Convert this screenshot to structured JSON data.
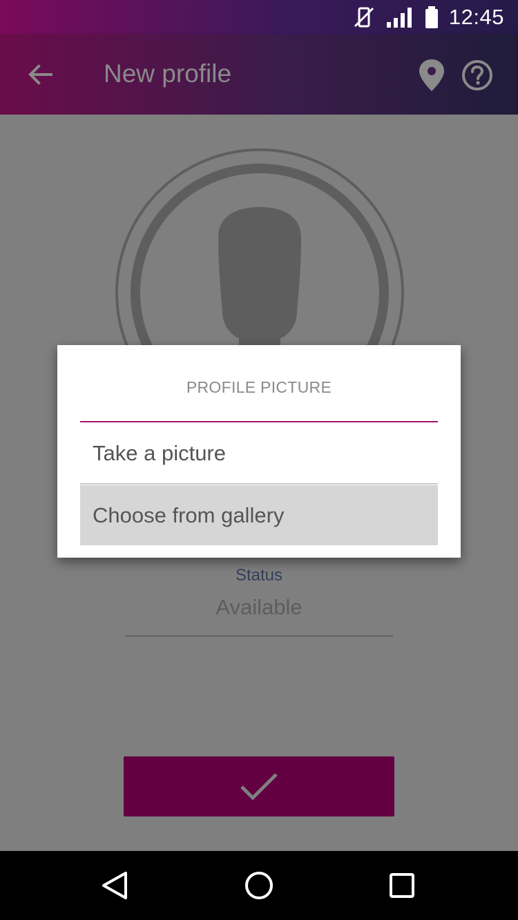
{
  "status_bar": {
    "time": "12:45",
    "icons": [
      "vibrate-mute-icon",
      "signal-icon",
      "battery-icon"
    ]
  },
  "app_bar": {
    "title": "New profile",
    "icons": [
      "back-arrow-icon",
      "location-pin-icon",
      "help-icon"
    ]
  },
  "profile": {
    "avatar_icon": "person-silhouette-icon",
    "status_label": "Status",
    "status_value": "Available",
    "confirm_icon": "checkmark-icon"
  },
  "dialog": {
    "title": "PROFILE PICTURE",
    "options": [
      {
        "label": "Take a picture",
        "highlighted": false
      },
      {
        "label": "Choose from gallery",
        "highlighted": true
      }
    ]
  },
  "nav_bar": {
    "icons": [
      "nav-back-icon",
      "nav-home-icon",
      "nav-recents-icon"
    ]
  },
  "colors": {
    "accent": "#a0146e",
    "confirm_button": "#630041",
    "scrim": "#7f7f7f"
  }
}
